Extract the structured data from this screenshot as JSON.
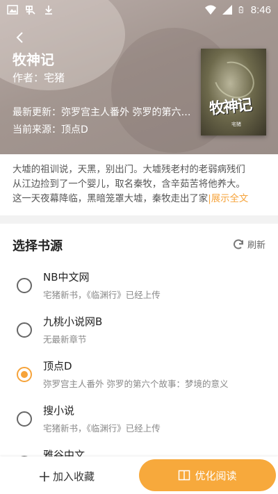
{
  "status_bar": {
    "time": "8:46"
  },
  "book": {
    "title": "牧神记",
    "author": "作者：宅猪",
    "latest_update": "最新更新：弥罗宫主人番外 弥罗的第六个故事：梦境的意义",
    "current_source": "当前来源：顶点D",
    "cover": {
      "title": "牧神记",
      "author": "宅猪"
    }
  },
  "description": {
    "lines": [
      "大墟的祖训说，天黑，别出门。大墟残老村的老弱病残们",
      "从江边捡到了一个婴儿，取名秦牧，含辛茹苦将他养大。",
      "这一天夜幕降临，黑暗笼罩大墟，秦牧走出了家"
    ],
    "show_all": "|展示全文"
  },
  "sources": {
    "title": "选择书源",
    "refresh": "刷新",
    "items": [
      {
        "name": "NB中文网",
        "latest": "宅猪新书，《临渊行》已经上传",
        "selected": false
      },
      {
        "name": "九桃小说网B",
        "latest": "无最新章节",
        "selected": false
      },
      {
        "name": "顶点D",
        "latest": "弥罗宫主人番外 弥罗的第六个故事：梦境的意义",
        "selected": true
      },
      {
        "name": "搜小说",
        "latest": "宅猪新书，《临渊行》已经上传",
        "selected": false
      },
      {
        "name": "雅谷中文",
        "latest": "",
        "selected": false
      }
    ]
  },
  "bottom_bar": {
    "add_favorite": "加入收藏",
    "read": "优化阅读"
  },
  "colors": {
    "accent": "#f6a33a",
    "header": "#a39690"
  }
}
